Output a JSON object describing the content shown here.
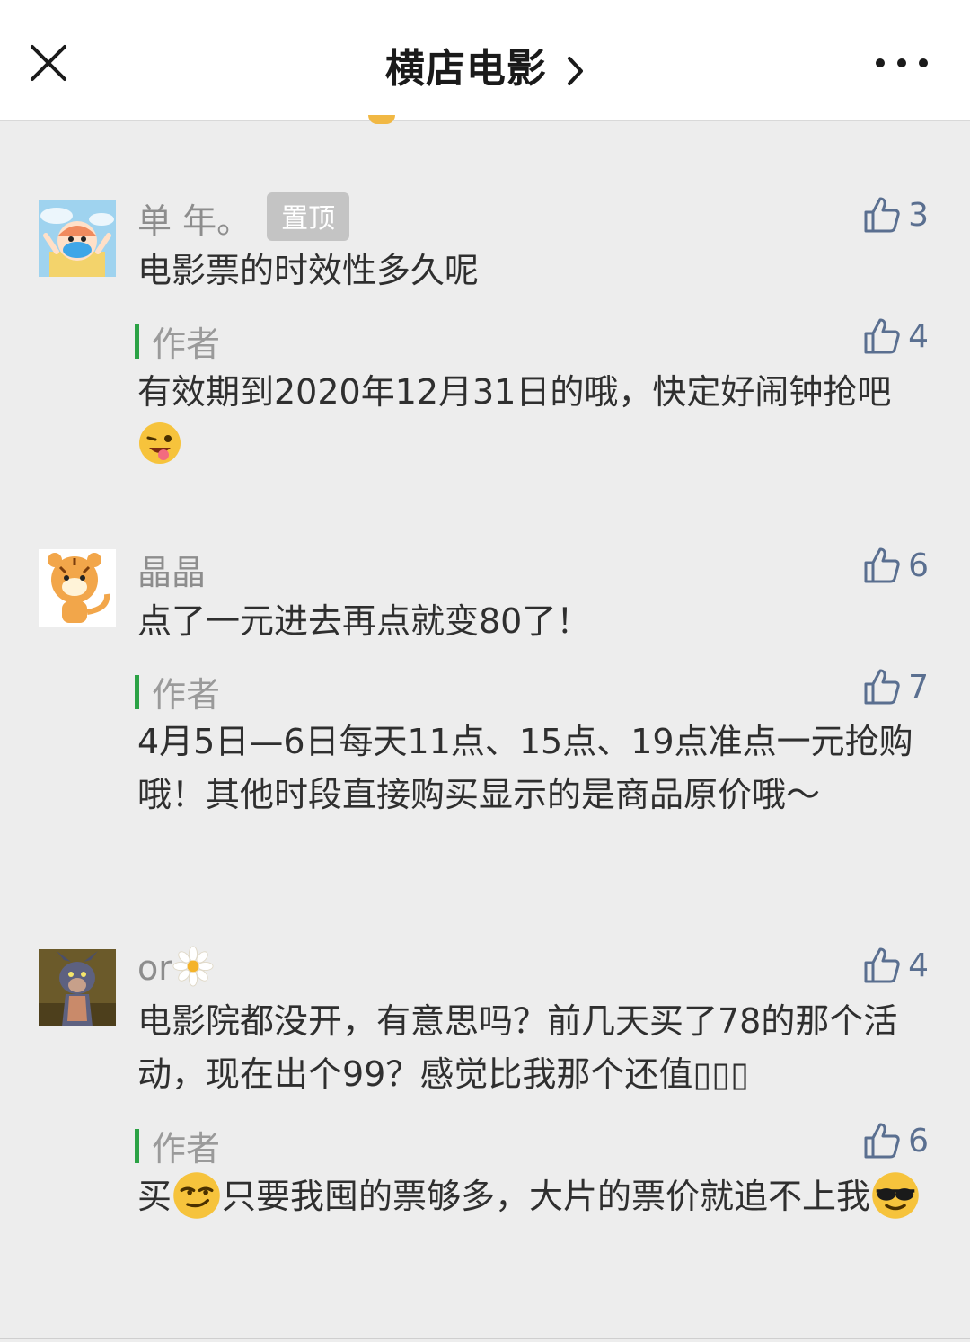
{
  "header": {
    "title": "横店电影",
    "close_icon": "close-icon",
    "more_icon": "more-icon"
  },
  "comments": [
    {
      "nickname": "单 年。",
      "pinned_label": "置顶",
      "likes": "3",
      "text": "电影票的时效性多久呢",
      "reply": {
        "author_label": "作者",
        "likes": "4",
        "text": "有效期到2020年12月31日的哦，快定好闹钟抢吧",
        "emoji": "winking-tongue-emoji"
      }
    },
    {
      "nickname": "晶晶",
      "likes": "6",
      "text": "点了一元进去再点就变80了！",
      "reply": {
        "author_label": "作者",
        "likes": "7",
        "text": "4月5日—6日每天11点、15点、19点准点一元抢购哦！其他时段直接购买显示的是商品原价哦～"
      }
    },
    {
      "nickname": "or",
      "nickname_emoji": "daisy-emoji",
      "likes": "4",
      "text": "电影院都没开，有意思吗？前几天买了78的那个活动，现在出个99？感觉比我那个还值▯▯▯",
      "reply": {
        "author_label": "作者",
        "likes": "6",
        "text_a": "买",
        "emoji_a": "smirk-emoji",
        "text_b": "只要我囤的票够多，大片的票价就追不上我",
        "emoji_b": "sunglasses-emoji"
      }
    }
  ],
  "colors": {
    "author_bar": "#2ba245",
    "like": "#5a6f90",
    "background": "#ededed"
  }
}
